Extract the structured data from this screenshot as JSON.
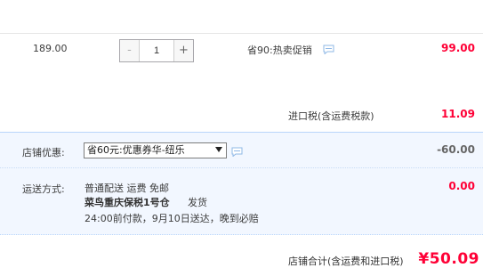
{
  "item": {
    "unit_price": "189.00",
    "quantity": {
      "minus_label": "-",
      "value": "1",
      "plus_label": "+"
    },
    "promo_text": "省90:热卖促销",
    "subtotal": "99.00"
  },
  "import_tax": {
    "label": "进口税(含运费税款)",
    "value": "11.09"
  },
  "store_coupon": {
    "label": "店铺优惠:",
    "selected_option": "省60元:优惠券华-纽乐",
    "value": "-60.00"
  },
  "shipping": {
    "label": "运送方式:",
    "method_line": "普通配送 运费 免邮",
    "warehouse": "菜鸟重庆保税1号仓",
    "dispatch_text": "发货",
    "promise_line": "24:00前付款，9月10日送达，晚到必赔",
    "value": "0.00"
  },
  "store_total": {
    "label": "店铺合计(含运费和进口税)",
    "value": "¥50.09"
  },
  "colors": {
    "price_red": "#ff0036",
    "blue_zone": "#f2f7ff",
    "blue_border": "#b9d6fa",
    "chat_icon": "#8fb8e6"
  }
}
